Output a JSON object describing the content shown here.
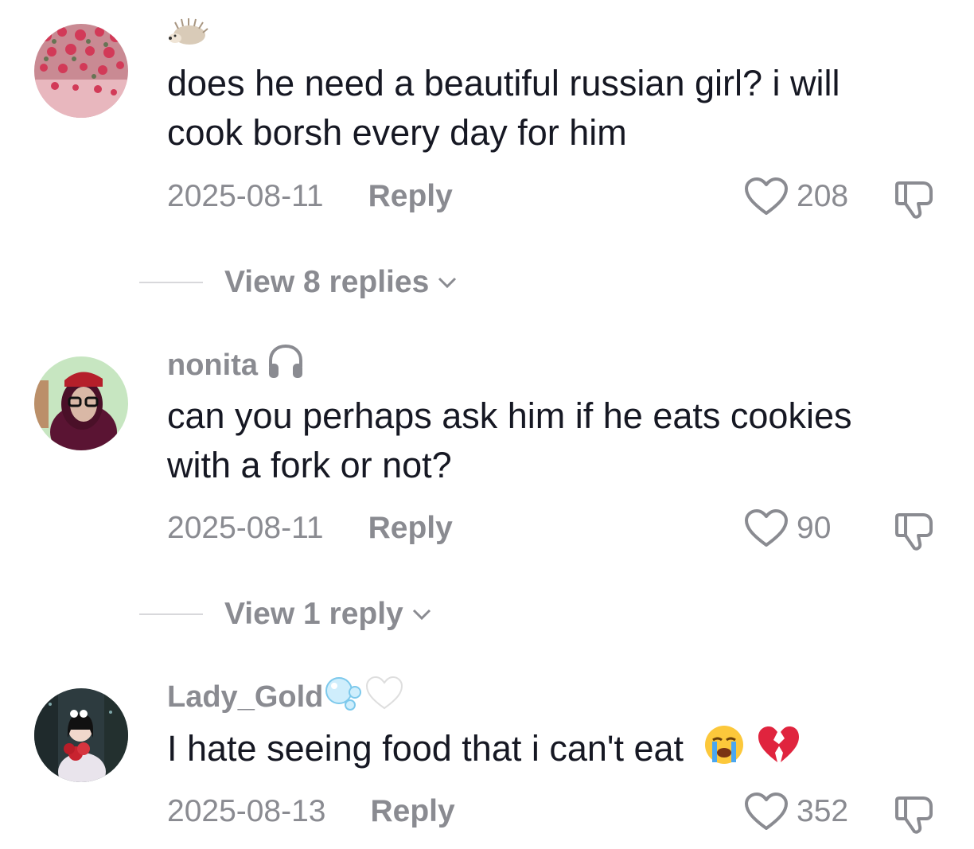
{
  "comments": [
    {
      "username": "",
      "username_badge": "hedgehog-emoji",
      "text_lines": [
        "does he need a beautiful russian girl? i will",
        "cook borsh every day for him"
      ],
      "date": "2025-08-11",
      "reply_label": "Reply",
      "likes": "208",
      "view_replies": "View 8 replies"
    },
    {
      "username": "nonita",
      "username_badge": "headphones-icon",
      "text_lines": [
        "can you perhaps ask him if he eats cookies",
        "with a fork or not?"
      ],
      "date": "2025-08-11",
      "reply_label": "Reply",
      "likes": "90",
      "view_replies": "View 1 reply"
    },
    {
      "username": "Lady_Gold",
      "username_badge": "bubbles-emoji white-heart-emoji",
      "text_lines": [
        "I hate seeing food that i can't eat"
      ],
      "text_emojis": [
        "loudly-crying-face-emoji",
        "broken-heart-emoji"
      ],
      "date": "2025-08-13",
      "reply_label": "Reply",
      "likes": "352"
    }
  ],
  "colors": {
    "text_primary": "#161823",
    "text_secondary": "#8a8b91",
    "divider": "#d8d8db",
    "background": "#ffffff"
  }
}
